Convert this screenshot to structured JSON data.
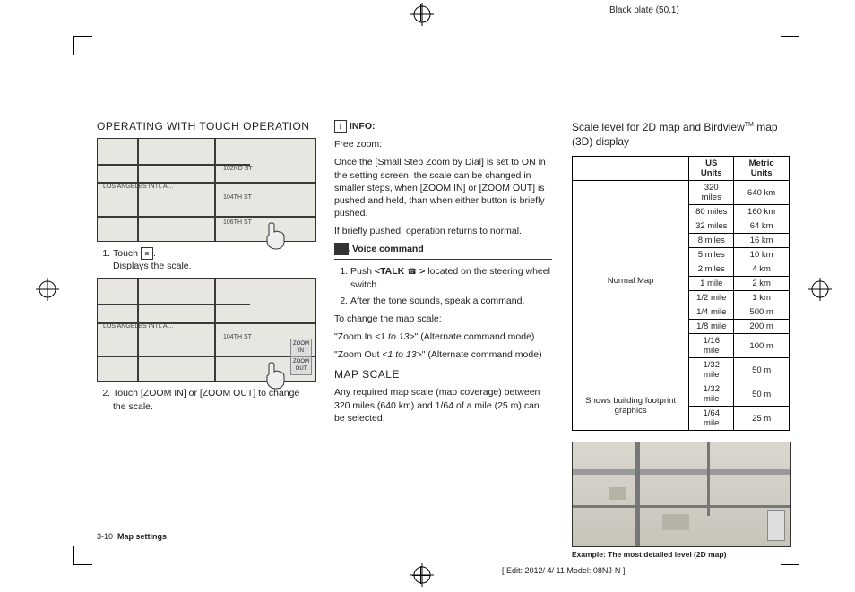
{
  "plate": "Black plate (50,1)",
  "col1": {
    "heading": "OPERATING WITH TOUCH OPERATION",
    "labels": {
      "los_angeles": "LOS ANGELES INTL A…",
      "st1": "104TH ST",
      "st2": "102ND ST",
      "st3": "106TH ST"
    },
    "step1_pre": "Touch ",
    "step1_icon": "≡",
    "step1_post": ".",
    "step1_caption": "Displays the scale.",
    "mapbtn": {
      "in": "ZOOM IN",
      "out": "ZOOM OUT"
    },
    "step2": "Touch [ZOOM IN] or [ZOOM OUT] to change the scale."
  },
  "col2": {
    "info_label": "INFO:",
    "freezoom": "Free zoom:",
    "freezoom_body": "Once the [Small Step Zoom by Dial] is set to ON in the setting screen, the scale can be changed in smaller steps, when [ZOOM IN] or [ZOOM OUT] is pushed and held, than when either button is briefly pushed.",
    "freezoom_body2": "If briefly pushed, operation returns to normal.",
    "vc_label": "Voice command",
    "vc_step1a": "Push ",
    "vc_step1b": "<TALK ",
    "vc_step1_glyph": "☎",
    "vc_step1c": " >",
    "vc_step1d": " located on the steering wheel switch.",
    "vc_step2": "After the tone sounds, speak a command.",
    "change_scale": "To change the map scale:",
    "zin1": "\"Zoom In ",
    "zin2": "<1 to 13>",
    "zin3": "\" (Alternate command mode)",
    "zout1": "\"Zoom Out ",
    "zout2": "<1 to 13>",
    "zout3": "\" (Alternate command mode)",
    "mapscale_h": "MAP SCALE",
    "mapscale_p": "Any required map scale (map coverage) between 320 miles (640 km) and 1/64 of a mile (25 m) can be selected."
  },
  "col3": {
    "heading_a": "Scale level for 2D map and Birdview",
    "heading_tm": "TM",
    "heading_b": "map (3D) display",
    "th_us": "US Units",
    "th_metric": "Metric Units",
    "row_normal": "Normal Map",
    "row_footprint": "Shows building footprint graphics",
    "rows_normal": [
      {
        "us": "320 miles",
        "m": "640 km"
      },
      {
        "us": "80 miles",
        "m": "160 km"
      },
      {
        "us": "32 miles",
        "m": "64 km"
      },
      {
        "us": "8 miles",
        "m": "16 km"
      },
      {
        "us": "5 miles",
        "m": "10 km"
      },
      {
        "us": "2 miles",
        "m": "4 km"
      },
      {
        "us": "1 mile",
        "m": "2 km"
      },
      {
        "us": "1/2 mile",
        "m": "1 km"
      },
      {
        "us": "1/4 mile",
        "m": "500 m"
      },
      {
        "us": "1/8 mile",
        "m": "200 m"
      },
      {
        "us": "1/16 mile",
        "m": "100 m"
      },
      {
        "us": "1/32 mile",
        "m": "50 m"
      }
    ],
    "rows_fp": [
      {
        "us": "1/32 mile",
        "m": "50 m"
      },
      {
        "us": "1/64 mile",
        "m": "25 m"
      }
    ],
    "caption": "Example: The most detailed level (2D map)"
  },
  "footer": {
    "pgnum": "3-10",
    "section": "Map settings"
  },
  "edit": "[ Edit: 2012/ 4/ 11   Model: 08NJ-N ]"
}
